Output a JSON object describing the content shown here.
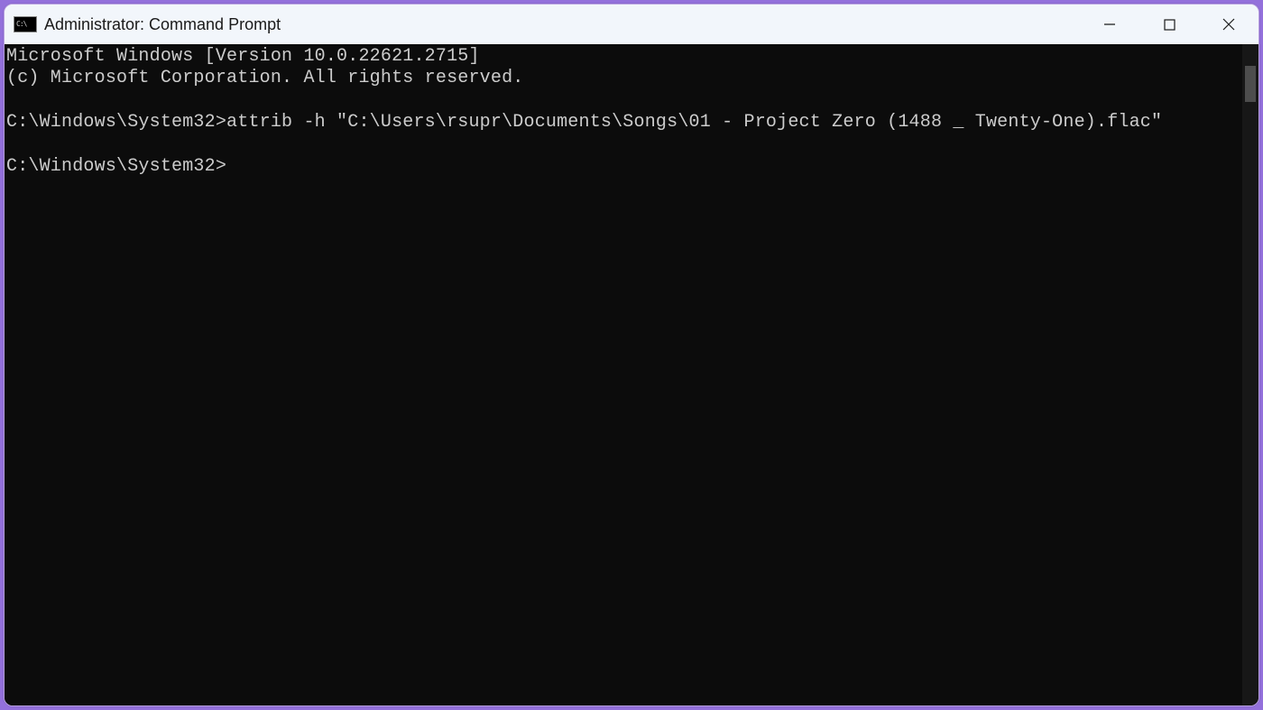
{
  "window": {
    "title": "Administrator: Command Prompt",
    "icon_label": "C:\\"
  },
  "terminal": {
    "lines": [
      "Microsoft Windows [Version 10.0.22621.2715]",
      "(c) Microsoft Corporation. All rights reserved.",
      "",
      "C:\\Windows\\System32>attrib -h \"C:\\Users\\rsupr\\Documents\\Songs\\01 - Project Zero (1488 _ Twenty-One).flac\"",
      "",
      "C:\\Windows\\System32>"
    ]
  }
}
